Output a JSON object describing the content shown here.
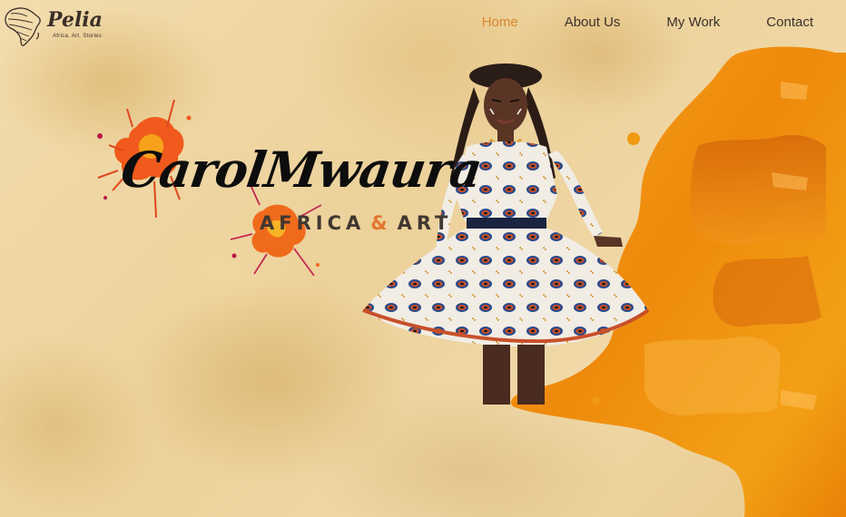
{
  "brand": {
    "name": "Pelia",
    "tagline": "Africa. Art. Stories",
    "logo_icon": "africa-map-icon"
  },
  "nav": {
    "items": [
      {
        "label": "Home",
        "active": true
      },
      {
        "label": "About Us",
        "active": false
      },
      {
        "label": "My Work",
        "active": false
      },
      {
        "label": "Contact",
        "active": false
      }
    ]
  },
  "hero": {
    "name": "CarolMwaura",
    "tagline_part1": "AFRICA",
    "tagline_amp": "&",
    "tagline_part2": "ART",
    "accent_color": "#e3762f"
  },
  "colors": {
    "nav_active": "#d8862e",
    "nav_text": "#3a3128",
    "splash_orange": "#f09a12"
  }
}
